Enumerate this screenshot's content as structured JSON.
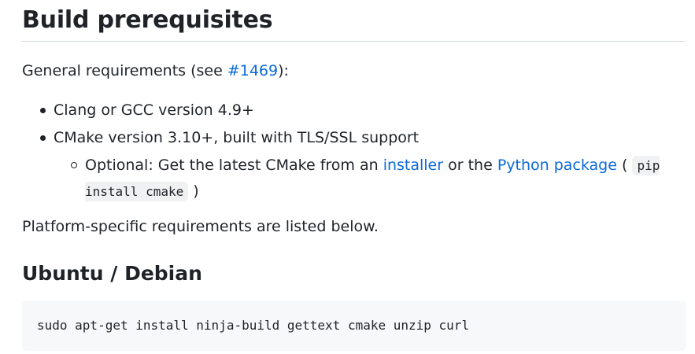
{
  "heading": "Build prerequisites",
  "general": {
    "prefix": "General requirements (see ",
    "link": "#1469",
    "suffix": "):"
  },
  "requirements": [
    {
      "text": "Clang or GCC version 4.9+"
    },
    {
      "text": "CMake version 3.10+, built with TLS/SSL support",
      "optional": {
        "prefix": "Optional: Get the latest CMake from an ",
        "installer_link": "installer",
        "middle": " or the ",
        "python_link": "Python package",
        "paren_open": " (",
        "code": "pip install cmake",
        "paren_close": ")"
      }
    }
  ],
  "platform_note": "Platform-specific requirements are listed below.",
  "subheading": "Ubuntu / Debian",
  "command": "sudo apt-get install ninja-build gettext cmake unzip curl"
}
